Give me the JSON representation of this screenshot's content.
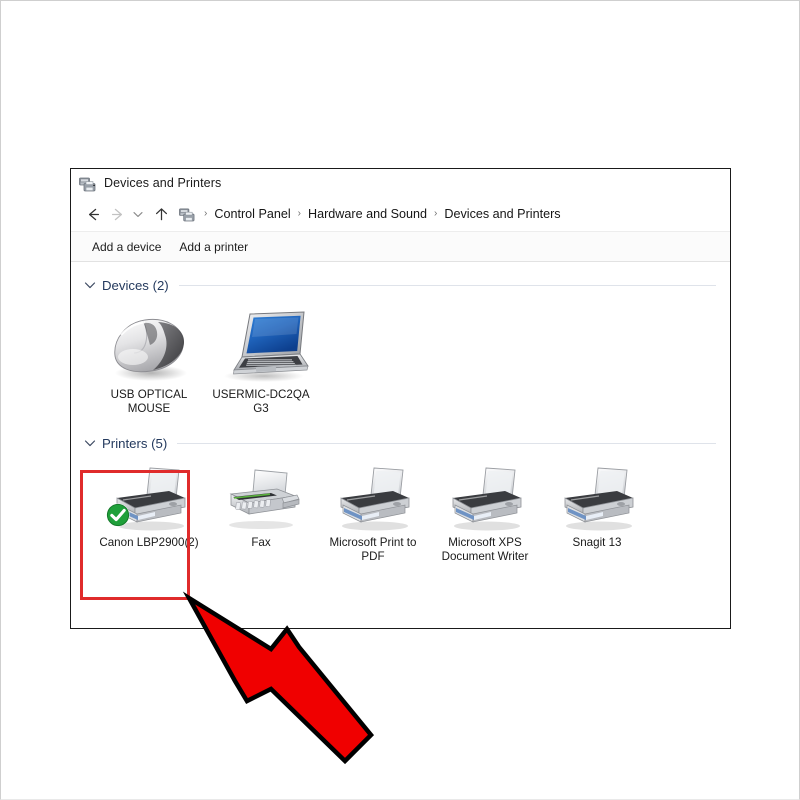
{
  "window": {
    "title": "Devices and Printers",
    "title_icon": "devices-and-printers-icon"
  },
  "navigation": {
    "back_icon": "back-arrow-icon",
    "forward_icon": "forward-arrow-icon",
    "recent_icon": "chevron-down-icon",
    "up_icon": "up-arrow-icon",
    "address_icon": "devices-and-printers-icon",
    "breadcrumbs": [
      {
        "label": "Control Panel"
      },
      {
        "label": "Hardware and Sound"
      },
      {
        "label": "Devices and Printers"
      }
    ],
    "separator": "›"
  },
  "toolbar": {
    "add_device_label": "Add a device",
    "add_printer_label": "Add a printer"
  },
  "sections": [
    {
      "id": "devices",
      "title": "Devices (2)",
      "chevron_icon": "chevron-down-icon",
      "items": [
        {
          "label": "USB OPTICAL MOUSE",
          "icon": "mouse-icon",
          "default": false
        },
        {
          "label": "USERMIC-DC2QA G3",
          "icon": "laptop-icon",
          "default": false
        }
      ]
    },
    {
      "id": "printers",
      "title": "Printers (5)",
      "chevron_icon": "chevron-down-icon",
      "items": [
        {
          "label": "Canon LBP2900(2)",
          "icon": "printer-icon",
          "default": true,
          "badge_icon": "green-check-badge-icon"
        },
        {
          "label": "Fax",
          "icon": "fax-icon",
          "default": false
        },
        {
          "label": "Microsoft Print to PDF",
          "icon": "printer-icon",
          "default": false
        },
        {
          "label": "Microsoft XPS Document Writer",
          "icon": "printer-icon",
          "default": false
        },
        {
          "label": "Snagit 13",
          "icon": "printer-icon",
          "default": false
        }
      ]
    }
  ],
  "annotations": {
    "highlight_color": "#e02b2b",
    "arrow_color": "#f00000",
    "arrow_icon": "red-pointer-arrow-icon",
    "highlight_target": "Canon LBP2900(2)"
  }
}
